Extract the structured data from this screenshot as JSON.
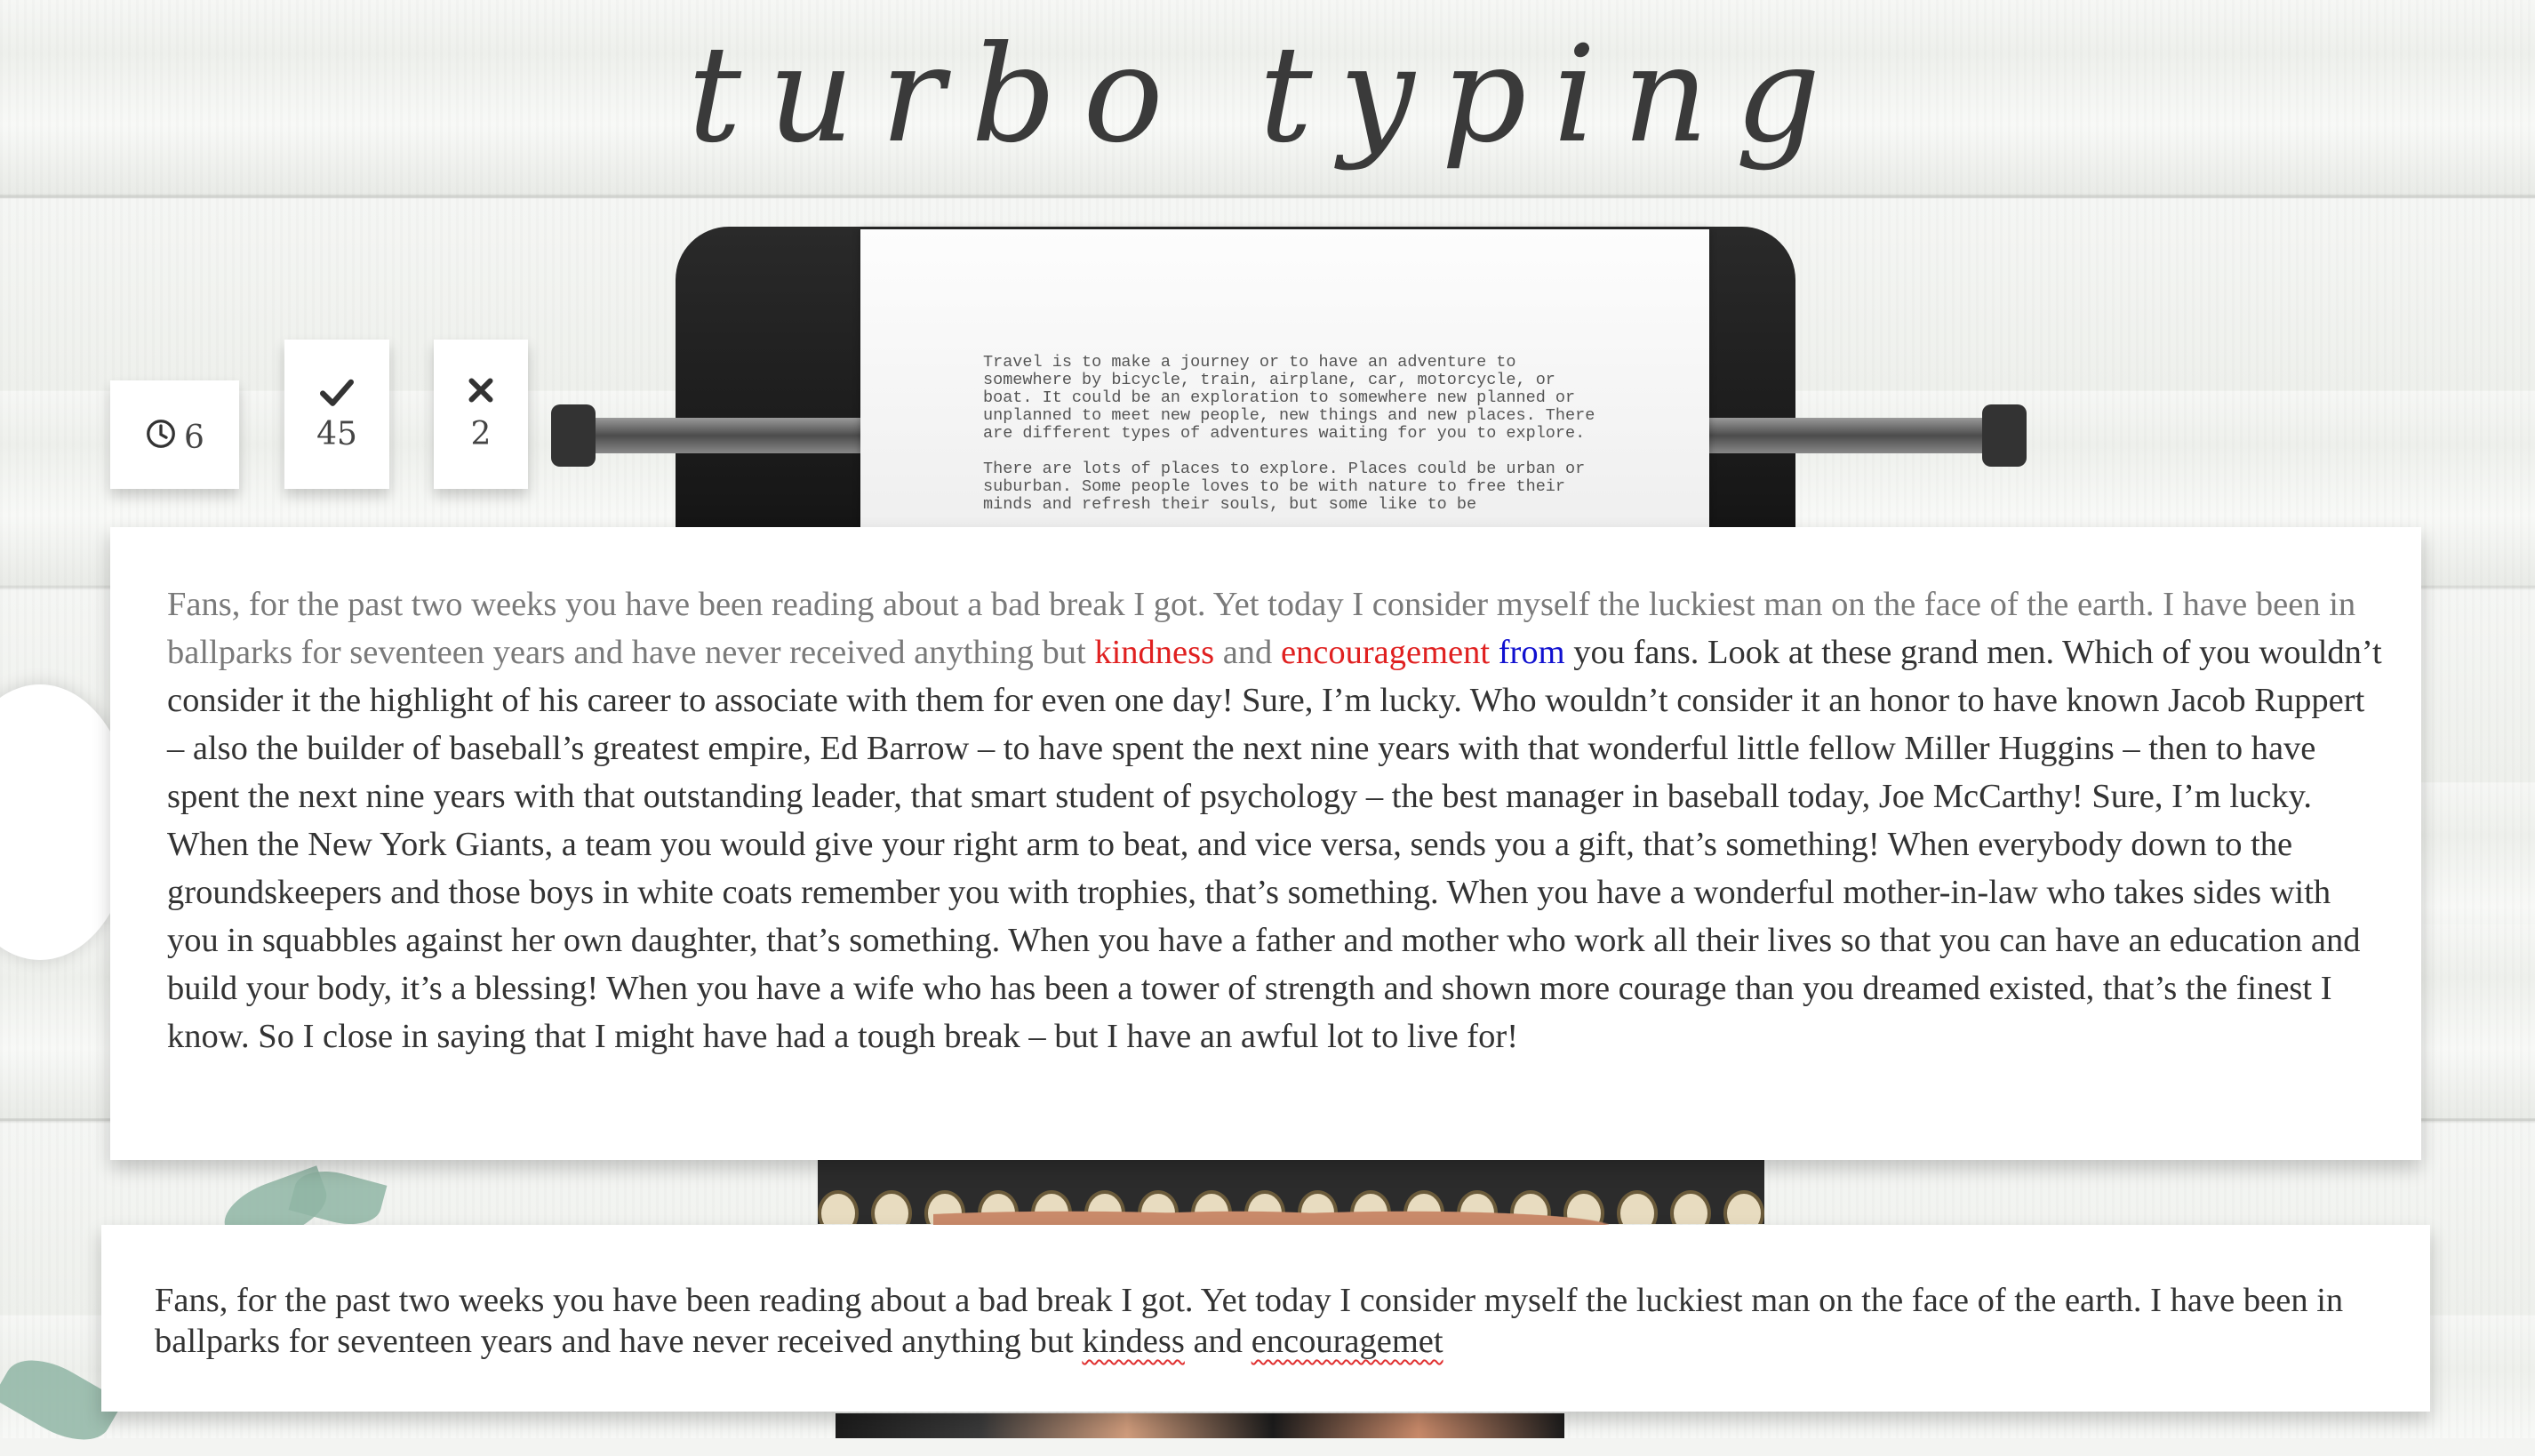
{
  "app": {
    "title": "turbo typing"
  },
  "stats": {
    "timer": {
      "icon": "clock-icon",
      "value": "6"
    },
    "correct": {
      "icon": "check-icon",
      "value": "45"
    },
    "wrong": {
      "icon": "x-icon",
      "value": "2"
    }
  },
  "paper": {
    "paragraph1": "Travel is to make a journey or to have an adventure to somewhere by bicycle, train, airplane, car, motorcycle, or boat. It could be an exploration to somewhere new planned or unplanned to meet new people, new things and new places. There are different types of adventures waiting for you to explore.",
    "paragraph2": "There are lots of places to explore. Places could be urban or suburban. Some people loves to be with nature to free their minds and refresh their souls, but some like to be"
  },
  "reference": {
    "typed": "Fans, for the past two weeks you have been reading about a bad break I got. Yet today I consider myself the luckiest man on the face of the earth. I have been in ballparks for seventeen years and have never received anything but ",
    "wrong1": "kindess",
    "wrong1_display": "kindness",
    "between": " and ",
    "wrong2": "encouragement",
    "space": " ",
    "current": "from",
    "rest": " you fans. Look at these grand men. Which of you wouldn’t consider it the highlight of his career to associate with them for even one day! Sure, I’m lucky. Who wouldn’t consider it an honor to have known Jacob Ruppert – also the builder of baseball’s greatest empire, Ed Barrow – to have spent the next nine years with that wonderful little fellow Miller Huggins – then to have spent the next nine years with that outstanding leader, that smart student of psychology – the best manager in baseball today, Joe McCarthy! Sure, I’m lucky. When the New York Giants, a team you would give your right arm to beat, and vice versa, sends you a gift, that’s something! When everybody down to the groundskeepers and those boys in white coats remember you with trophies, that’s something. When you have a wonderful mother-in-law who takes sides with you in squabbles against her own daughter, that’s something. When you have a father and mother who work all their lives so that you can have an education and build your body, it’s a blessing! When you have a wife who has been a tower of strength and shown more courage than you dreamed existed, that’s the finest I know. So I close in saying that I might have had a tough break – but I have an awful lot to live for!"
  },
  "input": {
    "prefix": "Fans, for the past two weeks you have been reading about a bad break I got. Yet today I consider myself the luckiest man on the face of the earth. I have been in ballparks for seventeen years and have never received anything but ",
    "word1": "kindess",
    "between": " and ",
    "word2": "encouragemet"
  }
}
